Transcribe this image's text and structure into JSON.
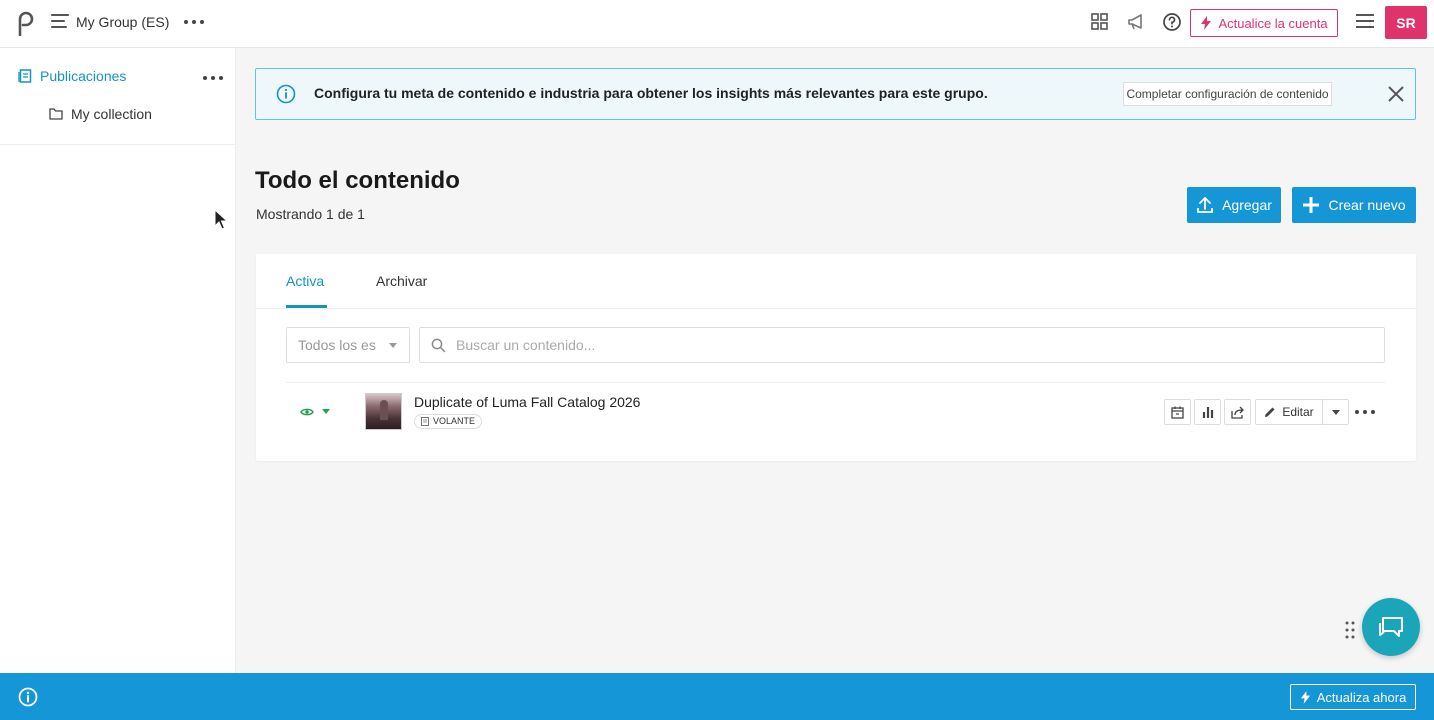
{
  "topbar": {
    "group_name": "My Group (ES)",
    "upgrade_label": "Actualice la cuenta",
    "avatar_initials": "SR"
  },
  "sidebar": {
    "items": [
      {
        "label": "Publicaciones",
        "icon": "publication-icon"
      },
      {
        "label": "My collection",
        "icon": "folder-icon"
      }
    ]
  },
  "banner": {
    "text": "Configura tu meta de contenido e industria para obtener los insights más relevantes para este grupo.",
    "button_label": "Completar configuración de contenido"
  },
  "header": {
    "title": "Todo el contenido",
    "subtitle": "Mostrando 1 de 1",
    "add_label": "Agregar",
    "create_label": "Crear nuevo"
  },
  "tabs": [
    {
      "label": "Activa",
      "active": true
    },
    {
      "label": "Archivar",
      "active": false
    }
  ],
  "filters": {
    "select_value": "Todos los es",
    "search_placeholder": "Buscar un contenido..."
  },
  "items": [
    {
      "title": "Duplicate of Luma Fall Catalog 2026",
      "tag": "VOLANTE",
      "edit_label": "Editar"
    }
  ],
  "footer": {
    "button_label": "Actualiza ahora"
  },
  "colors": {
    "accent": "#1596d6",
    "brand_pink": "#e0336b",
    "teal": "#1596b8",
    "chat": "#1aa5b8",
    "visible_green": "#2a9e52"
  }
}
